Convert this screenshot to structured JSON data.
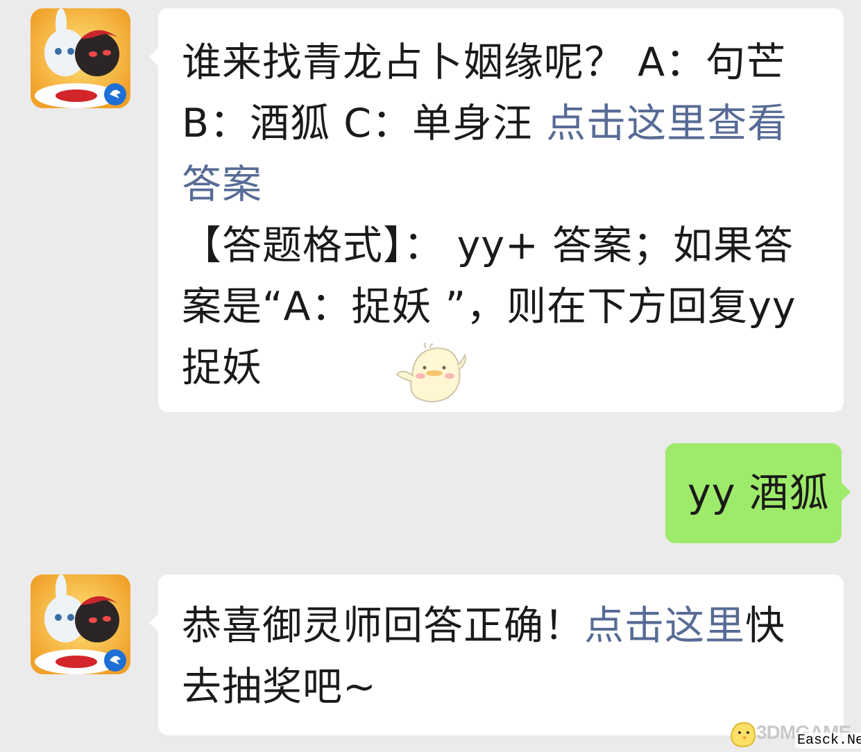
{
  "messages": [
    {
      "sender": "official-account",
      "question": "谁来找青龙占卜姻缘呢？ A：句芒 B：酒狐 C：单身汪 ",
      "link_text": "点击这里查看答案",
      "format_text": "【答题格式】： yy+ 答案；如果答案是“A：捉妖 ”，则在下方回复yy 捉妖"
    },
    {
      "sender": "me",
      "text": "yy 酒狐"
    },
    {
      "sender": "official-account",
      "text_before": "恭喜御灵师回答正确！",
      "link_text": "点击这里",
      "text_after": "快去抽奖吧~"
    }
  ],
  "watermark": {
    "logo": "3DMGAME",
    "site": "Easck.Net"
  },
  "colors": {
    "background": "#ebebeb",
    "bubble_in": "#ffffff",
    "bubble_out": "#9eea6a",
    "link": "#576b95",
    "avatar_bg": "#f6b73a"
  },
  "icons": [
    "game-avatar-icon",
    "chick-sticker-icon"
  ]
}
